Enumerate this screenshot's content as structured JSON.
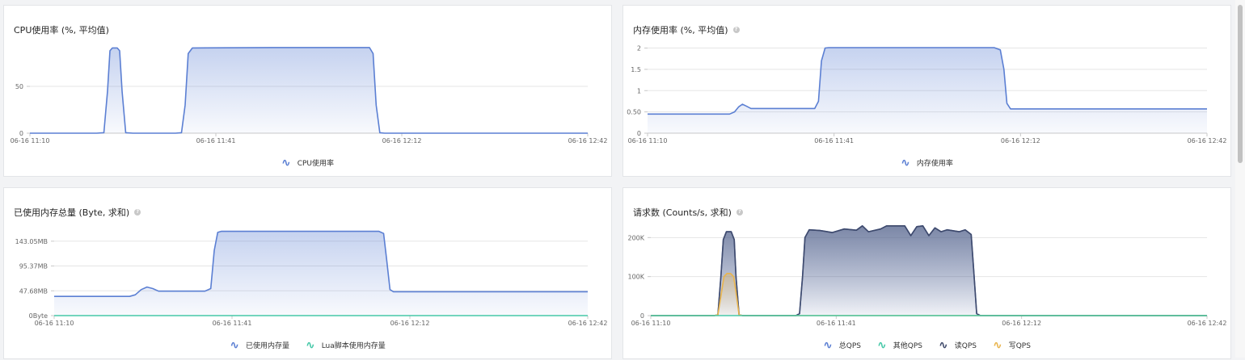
{
  "colors": {
    "blue": "#5b7fd3",
    "teal": "#46c8a8",
    "dark": "#3f4a6b",
    "orange": "#e9b44c",
    "grid": "#e5e5e5",
    "axis": "#c8c8c8",
    "tick": "#666666"
  },
  "panels": [
    {
      "title": "CPU使用率 (%, 平均值)",
      "show_help": false,
      "legend": [
        {
          "label": "CPU使用率",
          "color": "#5b7fd3"
        }
      ]
    },
    {
      "title": "内存使用率 (%, 平均值)",
      "show_help": true,
      "legend": [
        {
          "label": "内存使用率",
          "color": "#5b7fd3"
        }
      ]
    },
    {
      "title": "已使用内存总量 (Byte, 求和)",
      "show_help": true,
      "legend": [
        {
          "label": "已使用内存量",
          "color": "#5b7fd3"
        },
        {
          "label": "Lua脚本使用内存量",
          "color": "#46c8a8"
        }
      ]
    },
    {
      "title": "请求数 (Counts/s, 求和)",
      "show_help": true,
      "legend": [
        {
          "label": "总QPS",
          "color": "#5b7fd3"
        },
        {
          "label": "其他QPS",
          "color": "#46c8a8"
        },
        {
          "label": "读QPS",
          "color": "#3f4a6b"
        },
        {
          "label": "写QPS",
          "color": "#e9b44c"
        }
      ]
    }
  ],
  "chart_data": [
    {
      "type": "area",
      "title": "CPU使用率 (%, 平均值)",
      "x_ticks": [
        "06-16 11:10",
        "06-16 11:41",
        "06-16 12:12",
        "06-16 12:42"
      ],
      "xlim": [
        0,
        92
      ],
      "y_ticks": [
        {
          "v": 0,
          "label": "0"
        },
        {
          "v": 50,
          "label": "50"
        }
      ],
      "ylim": [
        0,
        100
      ],
      "series": [
        {
          "name": "CPU使用率",
          "color": "#5b7fd3",
          "fill": true,
          "points": [
            [
              0,
              0
            ],
            [
              11,
              0
            ],
            [
              12.2,
              0.5
            ],
            [
              12.8,
              45
            ],
            [
              13.2,
              88
            ],
            [
              13.6,
              91
            ],
            [
              14.4,
              91
            ],
            [
              14.8,
              88
            ],
            [
              15.2,
              45
            ],
            [
              15.8,
              0.5
            ],
            [
              17,
              0
            ],
            [
              24,
              0
            ],
            [
              25,
              0.5
            ],
            [
              25.6,
              30
            ],
            [
              26.1,
              85
            ],
            [
              26.8,
              91
            ],
            [
              40,
              91.5
            ],
            [
              56,
              91.5
            ],
            [
              56.6,
              85
            ],
            [
              57.1,
              30
            ],
            [
              57.7,
              0.5
            ],
            [
              58.5,
              0
            ],
            [
              92,
              0
            ]
          ]
        }
      ]
    },
    {
      "type": "area",
      "title": "内存使用率 (%, 平均值)",
      "x_ticks": [
        "06-16 11:10",
        "06-16 11:41",
        "06-16 12:12",
        "06-16 12:42"
      ],
      "xlim": [
        0,
        92
      ],
      "y_ticks": [
        {
          "v": 0,
          "label": "0"
        },
        {
          "v": 0.5,
          "label": "0.50"
        },
        {
          "v": 1,
          "label": "1"
        },
        {
          "v": 1.5,
          "label": "1.5"
        },
        {
          "v": 2,
          "label": "2"
        }
      ],
      "ylim": [
        0,
        2.2
      ],
      "series": [
        {
          "name": "内存使用率",
          "color": "#5b7fd3",
          "fill": true,
          "points": [
            [
              0,
              0.45
            ],
            [
              13.5,
              0.45
            ],
            [
              14.3,
              0.5
            ],
            [
              15,
              0.62
            ],
            [
              15.6,
              0.68
            ],
            [
              16.2,
              0.64
            ],
            [
              17,
              0.58
            ],
            [
              27.5,
              0.58
            ],
            [
              28.1,
              0.75
            ],
            [
              28.6,
              1.7
            ],
            [
              29.2,
              2.0
            ],
            [
              29.8,
              2.01
            ],
            [
              57,
              2.01
            ],
            [
              58,
              1.96
            ],
            [
              58.6,
              1.5
            ],
            [
              59.1,
              0.7
            ],
            [
              59.7,
              0.57
            ],
            [
              60.5,
              0.57
            ],
            [
              92,
              0.57
            ]
          ]
        }
      ]
    },
    {
      "type": "area",
      "title": "已使用内存总量 (Byte, 求和)",
      "x_ticks": [
        "06-16 11:10",
        "06-16 11:41",
        "06-16 12:12",
        "06-16 12:42"
      ],
      "xlim": [
        0,
        92
      ],
      "y_ticks": [
        {
          "v": 0,
          "label": "0Byte"
        },
        {
          "v": 47.68,
          "label": "47.68MB"
        },
        {
          "v": 95.37,
          "label": "95.37MB"
        },
        {
          "v": 143.05,
          "label": "143.05MB"
        }
      ],
      "ylim": [
        0,
        180
      ],
      "series": [
        {
          "name": "已使用内存量",
          "color": "#5b7fd3",
          "fill": true,
          "points": [
            [
              0,
              37
            ],
            [
              13,
              37
            ],
            [
              14,
              40
            ],
            [
              15,
              50
            ],
            [
              16,
              55
            ],
            [
              17,
              52
            ],
            [
              18,
              47
            ],
            [
              26,
              47
            ],
            [
              27,
              52
            ],
            [
              27.6,
              125
            ],
            [
              28.2,
              160
            ],
            [
              28.8,
              162
            ],
            [
              56,
              162
            ],
            [
              56.8,
              158
            ],
            [
              57.3,
              110
            ],
            [
              57.9,
              50
            ],
            [
              58.5,
              46
            ],
            [
              92,
              46
            ]
          ]
        },
        {
          "name": "Lua脚本使用内存量",
          "color": "#46c8a8",
          "fill": false,
          "points": [
            [
              0,
              0
            ],
            [
              92,
              0
            ]
          ]
        }
      ]
    },
    {
      "type": "area",
      "title": "请求数 (Counts/s, 求和)",
      "x_ticks": [
        "06-16 11:10",
        "06-16 11:41",
        "06-16 12:12",
        "06-16 12:42"
      ],
      "xlim": [
        0,
        92
      ],
      "y_ticks": [
        {
          "v": 0,
          "label": "0"
        },
        {
          "v": 100,
          "label": "100K"
        },
        {
          "v": 200,
          "label": "200K"
        }
      ],
      "ylim": [
        0,
        240
      ],
      "series": [
        {
          "name": "总QPS",
          "color": "#5b7fd3",
          "fill": true,
          "points": [
            [
              0,
              0
            ],
            [
              10.5,
              0
            ],
            [
              11.1,
              2
            ],
            [
              11.6,
              100
            ],
            [
              12,
              195
            ],
            [
              12.5,
              215
            ],
            [
              13.3,
              215
            ],
            [
              13.8,
              195
            ],
            [
              14.1,
              100
            ],
            [
              14.6,
              2
            ],
            [
              15.2,
              0
            ],
            [
              24,
              0
            ],
            [
              24.6,
              5
            ],
            [
              25.1,
              100
            ],
            [
              25.5,
              200
            ],
            [
              26.2,
              220
            ],
            [
              28,
              218
            ],
            [
              30,
              213
            ],
            [
              32,
              222
            ],
            [
              34,
              219
            ],
            [
              35,
              230
            ],
            [
              36,
              215
            ],
            [
              38,
              222
            ],
            [
              39,
              230
            ],
            [
              42,
              230
            ],
            [
              43,
              205
            ],
            [
              44,
              228
            ],
            [
              45,
              230
            ],
            [
              46,
              205
            ],
            [
              47,
              225
            ],
            [
              48,
              215
            ],
            [
              49,
              220
            ],
            [
              51,
              215
            ],
            [
              52,
              220
            ],
            [
              53,
              208
            ],
            [
              53.4,
              120
            ],
            [
              53.9,
              5
            ],
            [
              54.5,
              0
            ],
            [
              92,
              0
            ]
          ]
        },
        {
          "name": "读QPS",
          "color": "#3f4a6b",
          "fill": true,
          "points": [
            [
              0,
              0
            ],
            [
              10.5,
              0
            ],
            [
              11.1,
              2
            ],
            [
              11.6,
              100
            ],
            [
              12,
              195
            ],
            [
              12.5,
              215
            ],
            [
              13.3,
              215
            ],
            [
              13.8,
              195
            ],
            [
              14.1,
              100
            ],
            [
              14.6,
              2
            ],
            [
              15.2,
              0
            ],
            [
              24,
              0
            ],
            [
              24.6,
              5
            ],
            [
              25.1,
              100
            ],
            [
              25.5,
              200
            ],
            [
              26.2,
              220
            ],
            [
              28,
              218
            ],
            [
              30,
              213
            ],
            [
              32,
              222
            ],
            [
              34,
              219
            ],
            [
              35,
              230
            ],
            [
              36,
              215
            ],
            [
              38,
              222
            ],
            [
              39,
              230
            ],
            [
              42,
              230
            ],
            [
              43,
              205
            ],
            [
              44,
              228
            ],
            [
              45,
              230
            ],
            [
              46,
              205
            ],
            [
              47,
              225
            ],
            [
              48,
              215
            ],
            [
              49,
              220
            ],
            [
              51,
              215
            ],
            [
              52,
              220
            ],
            [
              53,
              208
            ],
            [
              53.4,
              120
            ],
            [
              53.9,
              5
            ],
            [
              54.5,
              0
            ],
            [
              92,
              0
            ]
          ]
        },
        {
          "name": "写QPS",
          "color": "#e9b44c",
          "fill": true,
          "points": [
            [
              0,
              0
            ],
            [
              10.5,
              0
            ],
            [
              11.1,
              2
            ],
            [
              11.7,
              60
            ],
            [
              12.1,
              100
            ],
            [
              12.6,
              108
            ],
            [
              13.2,
              108
            ],
            [
              13.7,
              100
            ],
            [
              14.1,
              60
            ],
            [
              14.6,
              2
            ],
            [
              15.2,
              0
            ],
            [
              92,
              0
            ]
          ]
        },
        {
          "name": "其他QPS",
          "color": "#46c8a8",
          "fill": false,
          "points": [
            [
              0,
              0
            ],
            [
              92,
              0
            ]
          ]
        }
      ]
    }
  ]
}
